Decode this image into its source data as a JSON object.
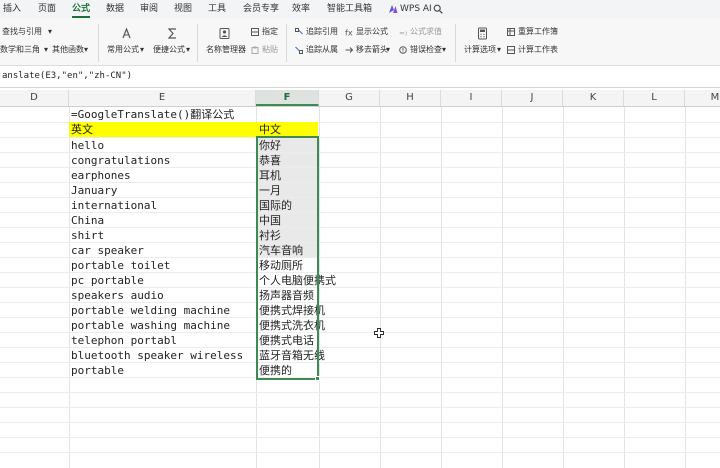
{
  "menu": {
    "tabs": [
      "插入",
      "页面",
      "公式",
      "数据",
      "审阅",
      "视图",
      "工具",
      "会员专享",
      "效率",
      "智能工具箱"
    ],
    "active_tab": "公式",
    "wps_ai": "WPS AI"
  },
  "ribbon": {
    "lookup": "查找与引用",
    "math": "数学和三角",
    "other_functions": "其他函数",
    "common_formula": "常用公式",
    "convenient_formula": "便捷公式",
    "name_manager": "名称管理器",
    "specify": "指定",
    "paste": "粘贴",
    "trace_precedents": "追踪引用",
    "trace_dependents": "追踪从属",
    "show_formulas": "显示公式",
    "remove_arrows": "移去箭头",
    "formula_evaluate": "公式求值",
    "error_check": "错误检查",
    "calc_options": "计算选项",
    "recalc_workbook": "重算工作簿",
    "calc_sheet": "计算工作表"
  },
  "formula_bar": {
    "text": "anslate(E3,\"en\",\"zh-CN\")"
  },
  "columns": [
    "D",
    "E",
    "F",
    "G",
    "H",
    "I",
    "J",
    "K",
    "L",
    "M"
  ],
  "selected_column": "F",
  "sheet": {
    "title": "=GoogleTranslate()翻译公式",
    "header_en": "英文",
    "header_zh": "中文",
    "rows": [
      {
        "en": "hello",
        "zh": "你好"
      },
      {
        "en": "congratulations",
        "zh": "恭喜"
      },
      {
        "en": "earphones",
        "zh": "耳机"
      },
      {
        "en": "January",
        "zh": "一月"
      },
      {
        "en": "international",
        "zh": "国际的"
      },
      {
        "en": "China",
        "zh": "中国"
      },
      {
        "en": "shirt",
        "zh": "衬衫"
      },
      {
        "en": "car speaker",
        "zh": "汽车音响"
      },
      {
        "en": "portable toilet",
        "zh": "移动厕所"
      },
      {
        "en": "pc portable",
        "zh": "个人电脑便携式"
      },
      {
        "en": "speakers audio",
        "zh": "扬声器音频"
      },
      {
        "en": "portable welding machine",
        "zh": "便携式焊接机"
      },
      {
        "en": "portable washing machine",
        "zh": "便携式洗衣机"
      },
      {
        "en": "telephon portabl",
        "zh": "便携式电话"
      },
      {
        "en": "bluetooth speaker wireless",
        "zh": "蓝牙音箱无线"
      },
      {
        "en": "portable",
        "zh": "便携的"
      }
    ]
  },
  "colors": {
    "accent": "#1f6f3f",
    "selection": "#3d8b52",
    "header_fill": "#ffff00"
  }
}
